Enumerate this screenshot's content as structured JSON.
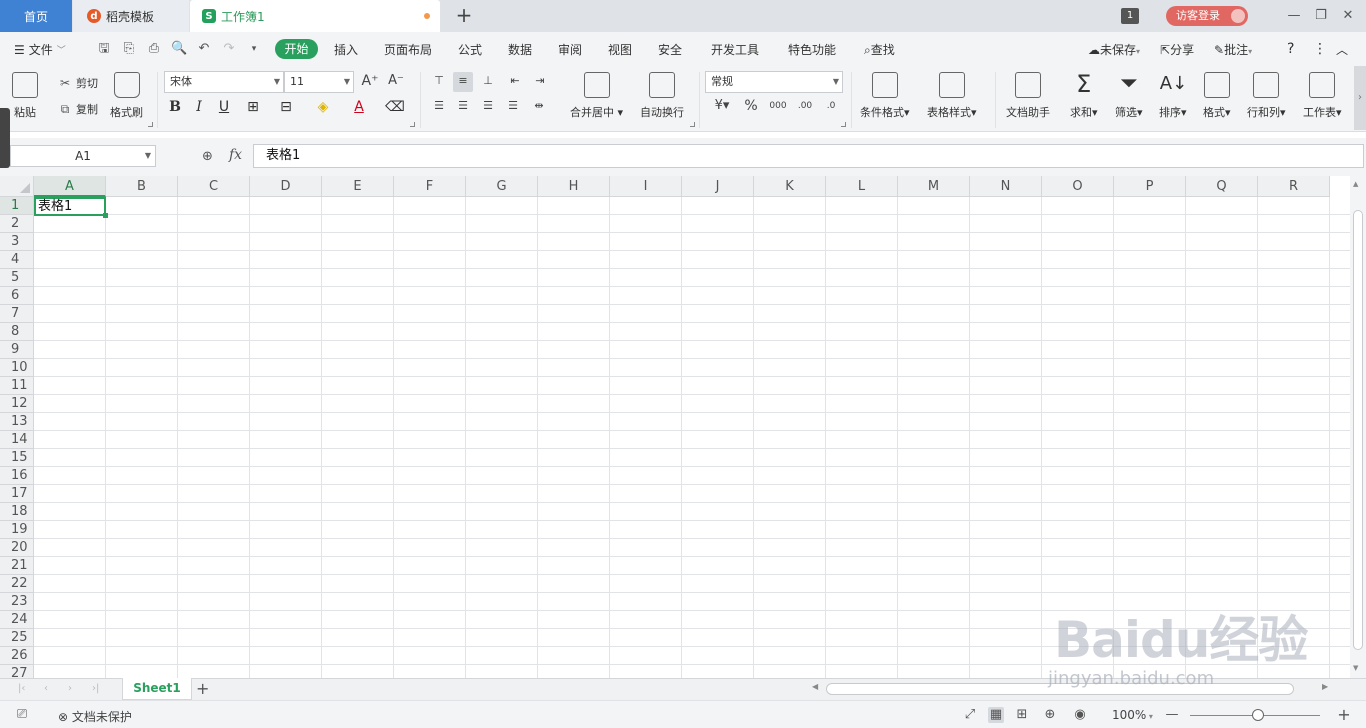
{
  "tabs": {
    "home": "首页",
    "docer": "稻壳模板",
    "workbook": "工作簿1",
    "window_count": "1",
    "login": "访客登录"
  },
  "menu": {
    "file": "文件",
    "tabs": [
      "开始",
      "插入",
      "页面布局",
      "公式",
      "数据",
      "审阅",
      "视图",
      "安全",
      "开发工具",
      "特色功能"
    ],
    "search": "查找",
    "unsaved": "未保存",
    "share": "分享",
    "comment": "批注"
  },
  "ribbon": {
    "paste": "粘贴",
    "cut": "剪切",
    "copy": "复制",
    "format_painter": "格式刷",
    "font_name": "宋体",
    "font_size": "11",
    "merge_center": "合并居中",
    "wrap_text": "自动换行",
    "number_format": "常规",
    "conditional_format": "条件格式",
    "table_style": "表格样式",
    "doc_assistant": "文档助手",
    "sum": "求和",
    "filter": "筛选",
    "sort": "排序",
    "format": "格式",
    "row_col": "行和列",
    "worksheet": "工作表"
  },
  "formula_bar": {
    "name_box": "A1",
    "fx": "fx",
    "content": "表格1"
  },
  "grid": {
    "columns": [
      "A",
      "B",
      "C",
      "D",
      "E",
      "F",
      "G",
      "H",
      "I",
      "J",
      "K",
      "L",
      "M",
      "N",
      "O",
      "P",
      "Q",
      "R"
    ],
    "rows": [
      "1",
      "2",
      "3",
      "4",
      "5",
      "6",
      "7",
      "8",
      "9",
      "10",
      "11",
      "12",
      "13",
      "14",
      "15",
      "16",
      "17",
      "18",
      "19",
      "20",
      "21",
      "22",
      "23",
      "24",
      "25",
      "26",
      "27"
    ],
    "a1_value": "表格1",
    "selected_cell": "A1"
  },
  "sheets": {
    "tabs": [
      "Sheet1"
    ],
    "active": "Sheet1"
  },
  "status": {
    "protection": "文档未保护",
    "zoom": "100%"
  },
  "watermark": {
    "brand": "Baidu经验",
    "url": "jingyan.baidu.com"
  },
  "colors": {
    "accent_green": "#2aa05e",
    "home_tab_blue": "#3f82d4",
    "login_red": "#e16862"
  }
}
